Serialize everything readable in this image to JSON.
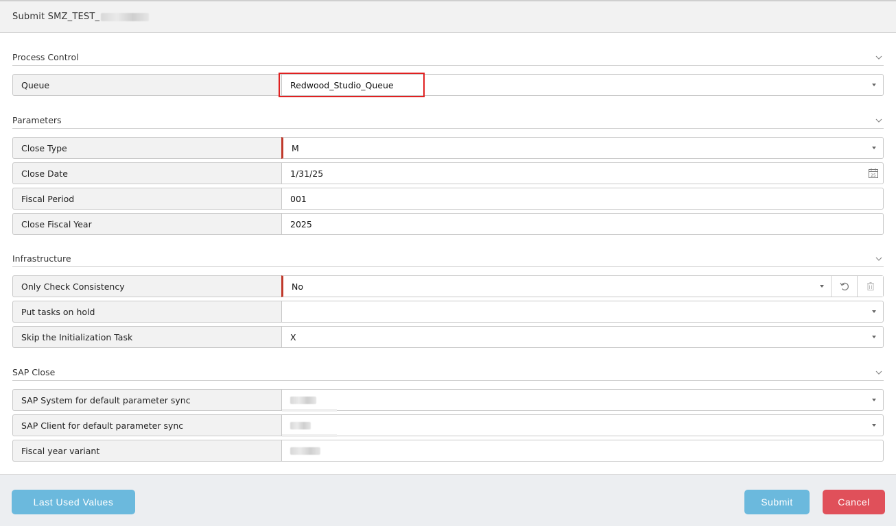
{
  "window": {
    "title": "Submit SMZ_TEST_"
  },
  "sections": {
    "process_control": {
      "title": "Process Control",
      "queue_label": "Queue",
      "queue_value": "Redwood_Studio_Queue"
    },
    "parameters": {
      "title": "Parameters",
      "close_type_label": "Close Type",
      "close_type_value": "M",
      "close_date_label": "Close Date",
      "close_date_value": "1/31/25",
      "fiscal_period_label": "Fiscal Period",
      "fiscal_period_value": "001",
      "close_fiscal_year_label": "Close Fiscal Year",
      "close_fiscal_year_value": "2025"
    },
    "infrastructure": {
      "title": "Infrastructure",
      "only_check_label": "Only Check Consistency",
      "only_check_value": "No",
      "put_hold_label": "Put tasks on hold",
      "put_hold_value": "",
      "skip_init_label": "Skip the Initialization Task",
      "skip_init_value": "X"
    },
    "sap_close": {
      "title": "SAP Close",
      "sap_system_label": "SAP System for default parameter sync",
      "sap_client_label": "SAP Client for default parameter sync",
      "fiscal_variant_label": "Fiscal year variant"
    }
  },
  "footer": {
    "last_used_label": "Last Used Values",
    "submit_label": "Submit",
    "cancel_label": "Cancel"
  },
  "colors": {
    "accent_blue": "#6bb9dd",
    "cancel_red": "#e0505a",
    "required_marker": "#c0392b",
    "highlight": "#e02020"
  },
  "icons": {
    "section_toggle": "chevron-down-icon",
    "dropdown": "caret-down-icon",
    "date_picker": "calendar-icon",
    "reset": "undo-icon",
    "clear": "trash-icon"
  }
}
